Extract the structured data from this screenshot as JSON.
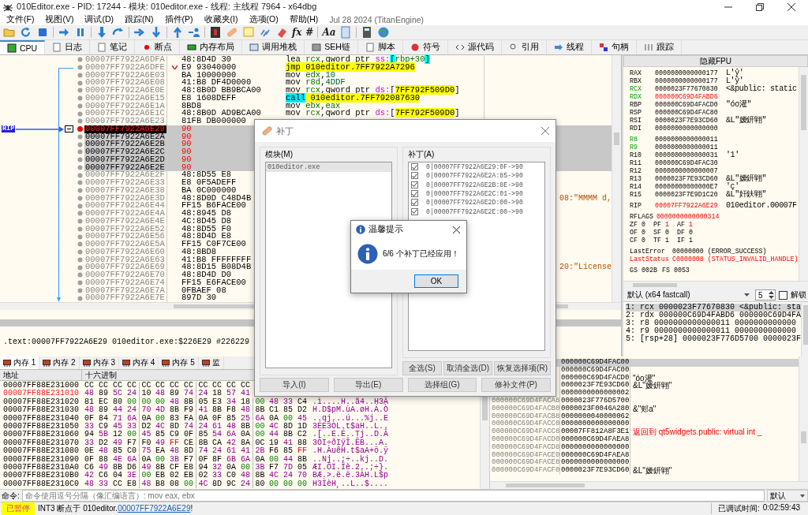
{
  "window": {
    "title": "010Editor.exe - PID: 17244 - 模块: 010editor.exe - 线程: 主线程 7964 - x64dbg"
  },
  "menu": [
    "文件(F)",
    "视图(V)",
    "调试(D)",
    "跟踪(N)",
    "插件(P)",
    "收藏夹(I)",
    "选项(O)",
    "帮助(H)"
  ],
  "build_info": "Jul 28 2024 (TitanEngine)",
  "toolbar": {
    "labels": [
      "fx",
      "#",
      "Aa"
    ]
  },
  "tabs": [
    {
      "label": "CPU",
      "selected": true
    },
    {
      "label": "日志",
      "selected": false
    },
    {
      "label": "笔记",
      "selected": false
    },
    {
      "label": "断点",
      "selected": false
    },
    {
      "label": "内存布局",
      "selected": false
    },
    {
      "label": "调用堆栈",
      "selected": false
    },
    {
      "label": "SEH链",
      "selected": false
    },
    {
      "label": "脚本",
      "selected": false
    },
    {
      "label": "符号",
      "selected": false
    },
    {
      "label": "源代码",
      "selected": false
    },
    {
      "label": "引用",
      "selected": false
    },
    {
      "label": "线程",
      "selected": false
    },
    {
      "label": "句柄",
      "selected": false
    },
    {
      "label": "跟踪",
      "selected": false
    }
  ],
  "disassembly": {
    "rip_label": "RIP",
    "rows": [
      {
        "address": "00007FF7922A6DFA",
        "bytes": "48:8D4D 30",
        "instruction": [
          {
            "text": "lea",
            "kind": "op"
          },
          {
            "text": " rcx",
            "kind": "reg"
          },
          {
            "text": ",qword ptr ",
            "kind": "plain"
          },
          {
            "text": "ss:",
            "kind": "seg"
          },
          {
            "text": "[",
            "kind": "br"
          },
          {
            "text": "rbp+30",
            "kind": "reg"
          },
          {
            "text": "]",
            "kind": "br"
          }
        ],
        "selected": false,
        "current": false,
        "breakpoint": false,
        "patched": false,
        "jump": false
      },
      {
        "address": "00007FF7922A6DFE",
        "bytes": "E9 93040000",
        "instruction": [
          {
            "text": "jmp",
            "kind": "jmp"
          },
          {
            "text": " 010editor.7FF7922A7296",
            "kind": "target"
          }
        ],
        "selected": false,
        "current": false,
        "breakpoint": false,
        "patched": false,
        "jump": true
      },
      {
        "address": "00007FF7922A6E03",
        "bytes": "BA 10000000",
        "instruction": [
          {
            "text": "mov",
            "kind": "op"
          },
          {
            "text": " edx",
            "kind": "reg"
          },
          {
            "text": ",",
            "kind": "plain"
          },
          {
            "text": "10",
            "kind": "num"
          }
        ],
        "selected": false,
        "current": false,
        "breakpoint": false,
        "patched": false,
        "jump": false
      },
      {
        "address": "00007FF7922A6E08",
        "bytes": "41:B8 DF4D0000",
        "instruction": [
          {
            "text": "mov",
            "kind": "op"
          },
          {
            "text": " r8d",
            "kind": "reg"
          },
          {
            "text": ",",
            "kind": "plain"
          },
          {
            "text": "4DDF",
            "kind": "num"
          }
        ],
        "selected": false,
        "current": false,
        "breakpoint": false,
        "patched": false,
        "jump": false
      },
      {
        "address": "00007FF7922A6E0E",
        "bytes": "48:8B0D BB9BCA00",
        "instruction": [
          {
            "text": "mov",
            "kind": "op"
          },
          {
            "text": " rcx",
            "kind": "reg"
          },
          {
            "text": ",qword ptr ",
            "kind": "plain"
          },
          {
            "text": "ds:",
            "kind": "seg"
          },
          {
            "text": "[",
            "kind": "plain"
          },
          {
            "text": "7FF792F509D0",
            "kind": "target"
          },
          {
            "text": "]",
            "kind": "plain"
          }
        ],
        "selected": false,
        "current": false,
        "breakpoint": false,
        "patched": false,
        "jump": false
      },
      {
        "address": "00007FF7922A6E15",
        "bytes": "E8 1608DEFF",
        "instruction": [
          {
            "text": "call",
            "kind": "call"
          },
          {
            "text": " 010editor.7FF792087630",
            "kind": "target"
          }
        ],
        "selected": false,
        "current": false,
        "breakpoint": false,
        "patched": false,
        "jump": false
      },
      {
        "address": "00007FF7922A6E1A",
        "bytes": "8BD8",
        "instruction": [
          {
            "text": "mov",
            "kind": "op"
          },
          {
            "text": " ebx",
            "kind": "reg"
          },
          {
            "text": ",",
            "kind": "plain"
          },
          {
            "text": "eax",
            "kind": "reg"
          }
        ],
        "selected": false,
        "current": false,
        "breakpoint": false,
        "patched": false,
        "jump": false
      },
      {
        "address": "00007FF7922A6E1C",
        "bytes": "48:8B0D AD9BCA00",
        "instruction": [
          {
            "text": "mov",
            "kind": "op"
          },
          {
            "text": " rcx",
            "kind": "reg"
          },
          {
            "text": ",qword ptr ",
            "kind": "plain"
          },
          {
            "text": "ds:",
            "kind": "seg"
          },
          {
            "text": "[",
            "kind": "plain"
          },
          {
            "text": "7FF792F509D0",
            "kind": "target"
          },
          {
            "text": "]",
            "kind": "plain"
          }
        ],
        "selected": false,
        "current": false,
        "breakpoint": false,
        "patched": false,
        "jump": false
      },
      {
        "address": "00007FF7922A6E23",
        "bytes": "81FB DB000000",
        "selected": false,
        "current": false,
        "breakpoint": false,
        "patched": false,
        "jump": false
      },
      {
        "address": "00007FF7922A6E29",
        "bytes": "90",
        "selected": true,
        "current": true,
        "breakpoint": true,
        "patched": true,
        "jump": false
      },
      {
        "address": "00007FF7922A6E2A",
        "bytes": "90",
        "selected": true,
        "current": false,
        "breakpoint": false,
        "patched": true,
        "jump": false
      },
      {
        "address": "00007FF7922A6E2B",
        "bytes": "90",
        "selected": true,
        "current": false,
        "breakpoint": false,
        "patched": true,
        "jump": false
      },
      {
        "address": "00007FF7922A6E2C",
        "bytes": "90",
        "selected": true,
        "current": false,
        "breakpoint": false,
        "patched": true,
        "jump": false
      },
      {
        "address": "00007FF7922A6E2D",
        "bytes": "90",
        "selected": true,
        "current": false,
        "breakpoint": false,
        "patched": true,
        "jump": false
      },
      {
        "address": "00007FF7922A6E2E",
        "bytes": "90",
        "selected": true,
        "current": false,
        "breakpoint": false,
        "patched": true,
        "jump": false
      },
      {
        "address": "00007FF7922A6E2F",
        "bytes": "48:8D55 E8",
        "selected": false,
        "current": false,
        "breakpoint": false,
        "patched": false,
        "jump": false
      },
      {
        "address": "00007FF7922A6E33",
        "bytes": "E8 0F5ADEFF",
        "selected": false,
        "current": false,
        "breakpoint": false,
        "patched": false,
        "jump": false
      },
      {
        "address": "00007FF7922A6E38",
        "bytes": "BA 0C000000",
        "selected": false,
        "current": false,
        "breakpoint": false,
        "patched": false,
        "jump": false
      },
      {
        "address": "00007FF7922A6E3D",
        "bytes": "48:8D0D C48D4B",
        "comment": "08:\"MMMM d,",
        "selected": false,
        "current": false,
        "breakpoint": false,
        "patched": false,
        "jump": false
      },
      {
        "address": "00007FF7922A6E44",
        "bytes": "FF15 B6FACE00",
        "selected": false,
        "current": false,
        "breakpoint": false,
        "patched": false,
        "jump": false
      },
      {
        "address": "00007FF7922A6E4A",
        "bytes": "48:8945 D8",
        "selected": false,
        "current": false,
        "breakpoint": false,
        "patched": false,
        "jump": false
      },
      {
        "address": "00007FF7922A6E4E",
        "bytes": "4C:8D45 D8",
        "selected": false,
        "current": false,
        "breakpoint": false,
        "patched": false,
        "jump": false
      },
      {
        "address": "00007FF7922A6E52",
        "bytes": "48:8D55 F0",
        "selected": false,
        "current": false,
        "breakpoint": false,
        "patched": false,
        "jump": false
      },
      {
        "address": "00007FF7922A6E56",
        "bytes": "48:8D4D E8",
        "selected": false,
        "current": false,
        "breakpoint": false,
        "patched": false,
        "jump": false
      },
      {
        "address": "00007FF7922A6E5A",
        "bytes": "FF15 C0F7CE00",
        "selected": false,
        "current": false,
        "breakpoint": false,
        "patched": false,
        "jump": false
      },
      {
        "address": "00007FF7922A6E60",
        "bytes": "48:8BD8",
        "selected": false,
        "current": false,
        "breakpoint": false,
        "patched": false,
        "jump": false
      },
      {
        "address": "00007FF7922A6E63",
        "bytes": "41:B8 FFFFFFFF",
        "selected": false,
        "current": false,
        "breakpoint": false,
        "patched": false,
        "jump": false
      },
      {
        "address": "00007FF7922A6E69",
        "bytes": "48:8D15 B08D4B",
        "comment": "20:\"License",
        "selected": false,
        "current": false,
        "breakpoint": false,
        "patched": false,
        "jump": false
      },
      {
        "address": "00007FF7922A6E70",
        "bytes": "48:8D4D D0",
        "selected": false,
        "current": false,
        "breakpoint": false,
        "patched": false,
        "jump": false
      },
      {
        "address": "00007FF7922A6E74",
        "bytes": "FF15 E6FACE00",
        "selected": false,
        "current": false,
        "breakpoint": false,
        "patched": false,
        "jump": false
      },
      {
        "address": "00007FF7922A6E7A",
        "bytes": "0FBAEF 08",
        "selected": false,
        "current": false,
        "breakpoint": false,
        "patched": false,
        "jump": false
      },
      {
        "address": "00007FF7922A6E7E",
        "bytes": "897D 30",
        "selected": false,
        "current": false,
        "breakpoint": false,
        "patched": false,
        "jump": false
      }
    ]
  },
  "registers": {
    "header": "隐藏FPU",
    "rows": [
      {
        "kind": "reg",
        "name": "RAX",
        "value": "0000000000000177",
        "comment": "L'ŷ'",
        "arg": false,
        "modified": false
      },
      {
        "kind": "reg",
        "name": "RBX",
        "value": "0000000000000177",
        "comment": "L'ŷ'",
        "arg": false,
        "modified": false
      },
      {
        "kind": "reg",
        "name": "RCX",
        "value": "0000023F77670830",
        "comment": "<&public: static",
        "arg": true,
        "modified": false
      },
      {
        "kind": "reg",
        "name": "RDX",
        "value": "000000C69D4FABD6",
        "arg": true,
        "modified": true
      },
      {
        "kind": "reg",
        "name": "RBP",
        "value": "000000C69D4FACD0",
        "comment": "\"óo灌\"",
        "arg": false,
        "modified": false
      },
      {
        "kind": "reg",
        "name": "RSP",
        "value": "000000C69D4FAC80",
        "arg": false,
        "modified": false
      },
      {
        "kind": "reg",
        "name": "RSI",
        "value": "0000023F7E93CD60",
        "comment": "&L\"嫒鈃翶\"",
        "arg": false,
        "modified": false
      },
      {
        "kind": "reg",
        "name": "RDI",
        "value": "0000000000000000",
        "arg": false,
        "modified": false
      },
      {
        "kind": "blank"
      },
      {
        "kind": "reg",
        "name": "R8",
        "value": "0000000000000011",
        "arg": true,
        "modified": false
      },
      {
        "kind": "reg",
        "name": "R9",
        "value": "0000000000000011",
        "arg": true,
        "modified": false
      },
      {
        "kind": "reg",
        "name": "R10",
        "value": "0000000000000031",
        "comment": "'1'",
        "arg": false,
        "modified": false
      },
      {
        "kind": "reg",
        "name": "R11",
        "value": "000000C69D4FAC30",
        "arg": false,
        "modified": false
      },
      {
        "kind": "reg",
        "name": "R12",
        "value": "0000000000000007",
        "arg": false,
        "modified": false
      },
      {
        "kind": "reg",
        "name": "R13",
        "value": "0000023F7E93CD60",
        "comment": "&L\"嫒鈃翶\"",
        "arg": false,
        "modified": false
      },
      {
        "kind": "reg",
        "name": "R14",
        "value": "00000000000000E7",
        "comment": "'ç'",
        "arg": false,
        "modified": false
      },
      {
        "kind": "reg",
        "name": "R15",
        "value": "0000023F7E9D1C20",
        "comment": "&L\"奸鈇翶\"",
        "arg": false,
        "modified": false
      },
      {
        "kind": "blank"
      },
      {
        "kind": "reg",
        "name": "RIP",
        "value": "00007FF7922A6E29",
        "comment": "010editor.00007F",
        "arg": false,
        "modified": true
      },
      {
        "kind": "blank"
      },
      {
        "kind": "reg",
        "name": "RFLAGS",
        "value": "0000000000000314",
        "arg": false,
        "modified": true
      },
      {
        "kind": "pairs",
        "items": [
          {
            "name": "ZF",
            "value": "0",
            "modified": false
          },
          {
            "name": "PF",
            "value": "1",
            "modified": true
          },
          {
            "name": "AF",
            "value": "1",
            "modified": true
          }
        ]
      },
      {
        "kind": "pairs",
        "items": [
          {
            "name": "OF",
            "value": "0",
            "modified": false
          },
          {
            "name": "SF",
            "value": "0",
            "modified": false
          },
          {
            "name": "DF",
            "value": "0",
            "modified": false
          }
        ]
      },
      {
        "kind": "pairs",
        "items": [
          {
            "name": "CF",
            "value": "0",
            "modified": false
          },
          {
            "name": "TF",
            "value": "1",
            "modified": false
          },
          {
            "name": "IF",
            "value": "1",
            "modified": false
          }
        ]
      },
      {
        "kind": "blank"
      },
      {
        "kind": "status",
        "name": "LastError",
        "value": "00000000",
        "comment": "(ERROR_SUCCESS)",
        "error": false
      },
      {
        "kind": "status",
        "name": "LastStatus",
        "value": "C0000008",
        "comment": "(STATUS_INVALID_HANDLE)",
        "error": true
      },
      {
        "kind": "blank"
      },
      {
        "kind": "pairs",
        "items": [
          {
            "name": "GS",
            "value": "002B",
            "modified": false
          },
          {
            "name": "FS",
            "value": "0053",
            "modified": false
          }
        ]
      }
    ]
  },
  "call_convention": {
    "value": "默认 (x64 fastcall)",
    "count": "5",
    "unlock_label": "解锁",
    "unlock_checked": false
  },
  "arguments": [
    {
      "text": "1: rcx 0000023F77670830 <&public: sta",
      "selected": true
    },
    {
      "text": "2: rdx 000000C69D4FABD6 000000C69D4FA",
      "selected": false
    },
    {
      "text": "3: r8 0000000000000011 0000000000000",
      "selected": false
    },
    {
      "text": "4: r9 0000000000000011 0000000000000",
      "selected": false
    },
    {
      "text": "5: [rsp+28] 0000023F776D5700 0000023F",
      "selected": false
    }
  ],
  "info_line": ".text:00007FF7922A6E29 010editor.exe:$226E29 #226229",
  "memory": {
    "tabs": [
      {
        "label": "内存 1",
        "selected": true
      },
      {
        "label": "内存 2",
        "selected": false
      },
      {
        "label": "内存 3",
        "selected": false
      },
      {
        "label": "内存 4",
        "selected": false
      },
      {
        "label": "内存 5",
        "selected": false
      },
      {
        "label": "监",
        "selected": false
      }
    ],
    "columns": [
      "地址",
      "十六进制"
    ],
    "rows": [
      {
        "address": "00007FF88E231000",
        "bytes": [
          "CC",
          "CC",
          "CC",
          "CC",
          "CC",
          "CC",
          "CC",
          "CC",
          "CC",
          "CC",
          "CC",
          "CC"
        ],
        "highlighted": false
      },
      {
        "address": "00007FF88E231010",
        "bytes": [
          "48",
          "89",
          "5C",
          "24",
          "10",
          "48",
          "89",
          "74",
          "24",
          "18",
          "57",
          "41"
        ],
        "highlighted": true
      },
      {
        "address": "00007FF88E231020",
        "bytes": [
          "81",
          "EC",
          "80",
          "00",
          "00",
          "00",
          "48",
          "8B",
          "05",
          "E3",
          "34",
          "18",
          "00",
          "48",
          "33",
          "C4"
        ],
        "ascii": ".ì....H..ã4..H3Ä",
        "highlighted": false
      },
      {
        "address": "00007FF88E231030",
        "bytes": [
          "48",
          "89",
          "44",
          "24",
          "70",
          "4D",
          "8B",
          "F9",
          "41",
          "8B",
          "F8",
          "48",
          "8B",
          "C1",
          "85",
          "D2"
        ],
        "ascii": "H.D$pM.ùA.øH.Á.Ò",
        "highlighted": false
      },
      {
        "address": "00007FF88E231040",
        "bytes": [
          "0F",
          "84",
          "71",
          "6A",
          "0A",
          "00",
          "83",
          "FA",
          "0A",
          "0F",
          "85",
          "25",
          "6A",
          "0A",
          "00",
          "45"
        ],
        "ascii": "..qj...ú...%j..E",
        "highlighted": false
      },
      {
        "address": "00007FF88E231050",
        "bytes": [
          "33",
          "C9",
          "45",
          "33",
          "D2",
          "4C",
          "8D",
          "74",
          "24",
          "61",
          "48",
          "8B",
          "00",
          "4C",
          "8D",
          "1D"
        ],
        "ascii": "3ÉE3ÒL.t$aH..L..",
        "highlighted": false
      },
      {
        "address": "00007FF88E231060",
        "bytes": [
          "94",
          "5B",
          "12",
          "00",
          "45",
          "85",
          "C9",
          "0F",
          "85",
          "54",
          "6A",
          "0A",
          "00",
          "44",
          "8B",
          "C2"
        ],
        "ascii": ".[..E.É..Tj..D.Â",
        "highlighted": false
      },
      {
        "address": "00007FF88E231070",
        "bytes": [
          "33",
          "D2",
          "49",
          "F7",
          "F0",
          "49",
          "FF",
          "CE",
          "8B",
          "CA",
          "42",
          "8A",
          "0C",
          "19",
          "41",
          "88"
        ],
        "ascii": "3ÒI÷ðIÿÎ.ÊB...A.",
        "highlighted": false
      },
      {
        "address": "00007FF88E231080",
        "bytes": [
          "0E",
          "48",
          "85",
          "C0",
          "75",
          "EA",
          "48",
          "8D",
          "74",
          "24",
          "61",
          "41",
          "2B",
          "F6",
          "85",
          "FF"
        ],
        "ascii": ".H.ÀuêH.t$aA+ö.ÿ",
        "highlighted": false
      },
      {
        "address": "00007FF88E231090",
        "bytes": [
          "0F",
          "88",
          "4E",
          "6A",
          "0A",
          "00",
          "3B",
          "F7",
          "0F",
          "8F",
          "6B",
          "6A",
          "0A",
          "00",
          "44",
          "8B"
        ],
        "ascii": "..Nj..;÷..kj..D.",
        "highlighted": false
      },
      {
        "address": "00007FF88E2310A0",
        "bytes": [
          "C6",
          "49",
          "8B",
          "D6",
          "49",
          "8B",
          "CF",
          "E8",
          "94",
          "32",
          "0A",
          "00",
          "3B",
          "F7",
          "7D",
          "05"
        ],
        "ascii": "ÆI.ÖI.Ïè.2..;÷}.",
        "highlighted": false
      },
      {
        "address": "00007FF88E2310B0",
        "bytes": [
          "42",
          "C6",
          "04",
          "3E",
          "00",
          "EB",
          "02",
          "EB",
          "02",
          "33",
          "C0",
          "48",
          "8B",
          "4C",
          "24",
          "70"
        ],
        "ascii": "BÆ.>.ë.ë.3ÀH.L$p",
        "highlighted": false
      },
      {
        "address": "00007FF88E2310C0",
        "bytes": [
          "48",
          "33",
          "CC",
          "E8",
          "48",
          "B8",
          "08",
          "00",
          "4C",
          "8D",
          "9C",
          "24",
          "80",
          "00",
          "00",
          "00"
        ],
        "ascii": "H3ÌèH¸..L..$....",
        "highlighted": false
      }
    ]
  },
  "stack": {
    "rows": [
      {
        "value": "000000C69D4FAC00",
        "selected": true
      },
      {
        "value": "000000C69D4FAC00",
        "selected": false
      },
      {
        "value": "000000C69D4FACD0",
        "comment": "\"óo灌\"",
        "selected": false,
        "return": false
      },
      {
        "value": "0000023F7E93CD60",
        "comment": "&L\"嫒鈃翶\"",
        "selected": false,
        "return": false
      },
      {
        "value": "0000000000000002",
        "selected": false
      },
      {
        "address": "000000C69D4FACA8",
        "value": "0000023F776D5700",
        "selected": false
      },
      {
        "address": "000000C69D4FACB0",
        "value": "0000023F0046A280",
        "comment": "&\"郏a\"",
        "selected": false,
        "return": false
      },
      {
        "address": "000000C69D4FACB8",
        "value": "0000000040000062",
        "selected": false
      },
      {
        "address": "000000C69D4FACC0",
        "value": "0000000000000000",
        "selected": false
      },
      {
        "address": "000000C69D4FACC8",
        "value": "00007FF812A8F3E1",
        "comment": "返回到 qt5widgets.public: virtual int _",
        "selected": false,
        "return": true
      },
      {
        "address": "000000C69D4FACD0",
        "value": "000000C69D4FAEA8",
        "selected": false
      },
      {
        "address": "000000C69D4FACD8",
        "value": "0000000000000000",
        "selected": false
      },
      {
        "address": "000000C69D4FACE0",
        "value": "000000C69D4FAEA8",
        "selected": false
      },
      {
        "address": "000000C69D4FACE8",
        "value": "0000000000000000",
        "selected": false
      },
      {
        "address": "000000C69D4FACF0",
        "value": "0000023F7E93CD60",
        "comment": "&L\"嫒鈃翶\"",
        "selected": false,
        "return": false
      }
    ]
  },
  "command": {
    "label": "命令:",
    "placeholder": "命令使用逗号分隔（像汇编语言）: mov eax, ebx",
    "mode": "默认"
  },
  "status": {
    "state": "已暂停",
    "message_prefix": "INT3 断点于 010editor.",
    "link": "00007FF7922A6E29",
    "message_suffix": "!",
    "elapsed_label": "已调试时间:",
    "elapsed": "0:02:59:43"
  },
  "patch_dialog": {
    "title": "补丁",
    "modules_label": "模块(M)",
    "modules": [
      {
        "name": "010editor.exe",
        "selected": true
      }
    ],
    "patches_label": "补丁(A)",
    "patches": [
      {
        "text": "0|00007FF7922A6E29:0F->90",
        "checked": true
      },
      {
        "text": "0|00007FF7922A6E2A:85->90",
        "checked": true
      },
      {
        "text": "0|00007FF7922A6E2B:8E->90",
        "checked": true
      },
      {
        "text": "0|00007FF7922A6E2C:01->90",
        "checked": true
      },
      {
        "text": "0|00007FF7922A6E2D:00->90",
        "checked": true
      },
      {
        "text": "0|00007FF7922A6E2E:00->90",
        "checked": true
      }
    ],
    "buttons": [
      "全选(S)",
      "取消全选(D)",
      "恢复选择项(R)"
    ],
    "footer_buttons": [
      "导入(I)",
      "导出(E)",
      "选择组(G)",
      "修补文件(P)"
    ]
  },
  "message_box": {
    "title": "温馨提示",
    "text": "6/6 个补丁已经应用！",
    "button": "OK"
  }
}
